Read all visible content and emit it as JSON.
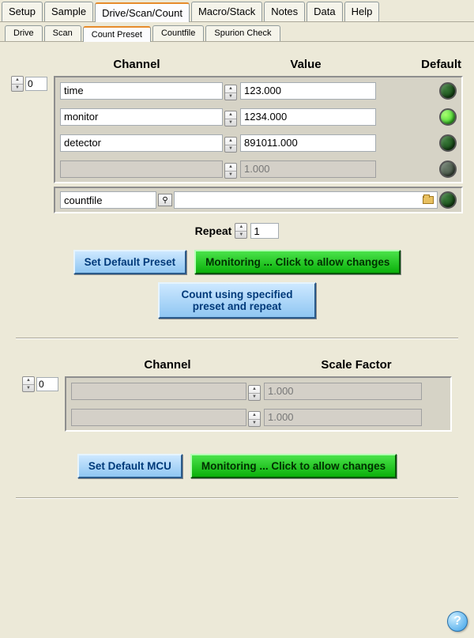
{
  "main_tabs": [
    "Setup",
    "Sample",
    "Drive/Scan/Count",
    "Macro/Stack",
    "Notes",
    "Data",
    "Help"
  ],
  "main_active": 2,
  "sub_tabs": [
    "Drive",
    "Scan",
    "Count Preset",
    "Countfile",
    "Spurion Check"
  ],
  "sub_active": 2,
  "preset": {
    "headers": {
      "channel": "Channel",
      "value": "Value",
      "default": "Default"
    },
    "index": "0",
    "rows": [
      {
        "channel": "time",
        "value": "123.000",
        "led": "dark",
        "enabled": true
      },
      {
        "channel": "monitor",
        "value": "1234.000",
        "led": "on",
        "enabled": true
      },
      {
        "channel": "detector",
        "value": "891011.000",
        "led": "dark",
        "enabled": true
      },
      {
        "channel": "",
        "value": "1.000",
        "led": "dim",
        "enabled": false
      }
    ],
    "countfile": {
      "label": "countfile",
      "path": "",
      "led": "dark"
    },
    "repeat_label": "Repeat",
    "repeat_value": "1",
    "set_default_btn": "Set Default Preset",
    "monitoring_btn": "Monitoring ... Click to allow changes",
    "count_btn": "Count using specified preset and repeat"
  },
  "mcu": {
    "headers": {
      "channel": "Channel",
      "scale": "Scale Factor"
    },
    "index": "0",
    "rows": [
      {
        "channel": "",
        "value": "1.000"
      },
      {
        "channel": "",
        "value": "1.000"
      }
    ],
    "set_default_btn": "Set Default MCU",
    "monitoring_btn": "Monitoring ... Click to allow changes"
  },
  "help_glyph": "?"
}
